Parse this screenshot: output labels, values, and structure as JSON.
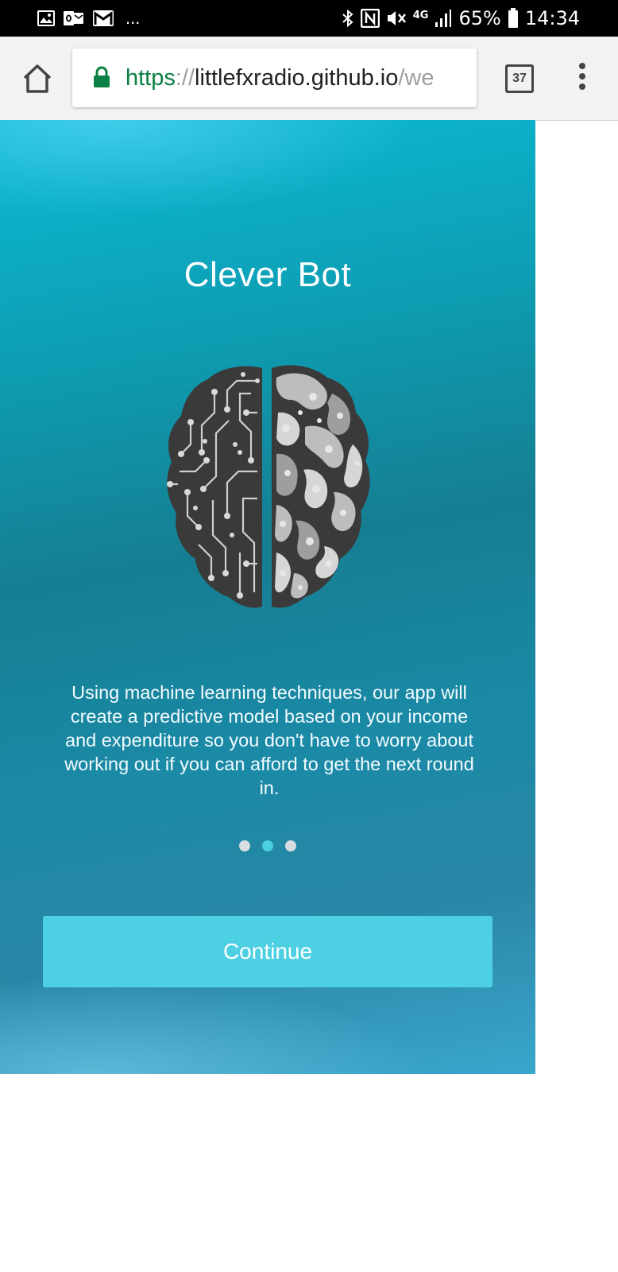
{
  "status_bar": {
    "notification_icons": [
      "image-icon",
      "outlook-icon",
      "gmail-icon"
    ],
    "more_notifications": "...",
    "system_icons": [
      "bluetooth-icon",
      "nfc-icon",
      "vibrate-icon",
      "4g-icon",
      "signal-icon",
      "battery-icon"
    ],
    "network_label": "4G",
    "battery_percent": "65%",
    "time": "14:34"
  },
  "browser": {
    "url_scheme": "https",
    "url_separator": "://",
    "url_host": "littlefxradio.github.io",
    "url_path": "/we",
    "tab_count": "37",
    "icons": {
      "home": "home-icon",
      "lock": "lock-icon",
      "menu": "more-vert-icon"
    },
    "colors": {
      "secure_green": "#0b8043",
      "url_gray": "#9e9e9e"
    }
  },
  "onboarding": {
    "title": "Clever Bot",
    "illustration": "brain-icon",
    "description": "Using machine learning techniques, our app will create a predictive model based on your income and expenditure so you don't have to worry about working out if you can afford to get the next round in.",
    "pager": {
      "total": 3,
      "active_index": 1
    },
    "continue_label": "Continue",
    "colors": {
      "gradient_top": "#0bbad6",
      "gradient_mid": "#167e92",
      "gradient_bottom": "#3aa6cc",
      "button": "#4dd0e3",
      "dot_active": "#4dcfe2",
      "dot_inactive": "#d7dde1"
    }
  }
}
